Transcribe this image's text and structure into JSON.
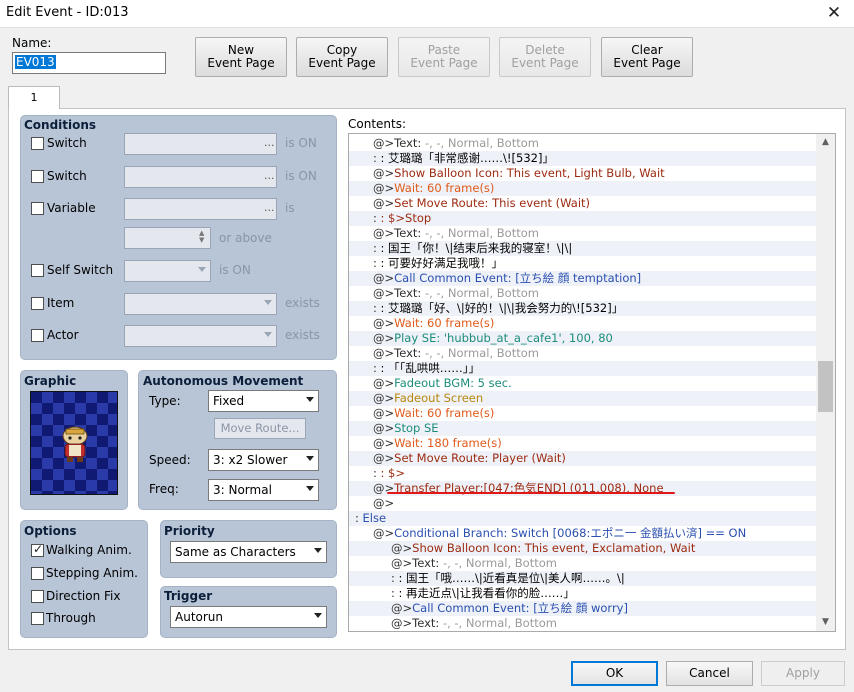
{
  "window": {
    "title": "Edit Event - ID:013",
    "close_glyph": "✕"
  },
  "name": {
    "label": "Name:",
    "value": "EV013"
  },
  "top_buttons": [
    {
      "line1": "New",
      "line2": "Event Page",
      "enabled": true
    },
    {
      "line1": "Copy",
      "line2": "Event Page",
      "enabled": true
    },
    {
      "line1": "Paste",
      "line2": "Event Page",
      "enabled": false
    },
    {
      "line1": "Delete",
      "line2": "Event Page",
      "enabled": false
    },
    {
      "line1": "Clear",
      "line2": "Event Page",
      "enabled": true
    }
  ],
  "tabs": [
    {
      "label": "1"
    }
  ],
  "conditions": {
    "title": "Conditions",
    "switch1": {
      "label": "Switch",
      "suffix": "is ON",
      "dots": "..."
    },
    "switch2": {
      "label": "Switch",
      "suffix": "is ON",
      "dots": "..."
    },
    "variable": {
      "label": "Variable",
      "suffix": "is",
      "dots": "...",
      "or_above": "or above"
    },
    "self_switch": {
      "label": "Self Switch",
      "suffix": "is ON"
    },
    "item": {
      "label": "Item",
      "suffix": "exists"
    },
    "actor": {
      "label": "Actor",
      "suffix": "exists"
    }
  },
  "graphic": {
    "title": "Graphic",
    "icon": "character-sprite-icon"
  },
  "autonomous": {
    "title": "Autonomous Movement",
    "type_label": "Type:",
    "type_value": "Fixed",
    "move_route": "Move Route...",
    "speed_label": "Speed:",
    "speed_value": "3: x2 Slower",
    "freq_label": "Freq:",
    "freq_value": "3: Normal"
  },
  "options": {
    "title": "Options",
    "items": [
      {
        "label": "Walking Anim.",
        "checked": true
      },
      {
        "label": "Stepping Anim.",
        "checked": false
      },
      {
        "label": "Direction Fix",
        "checked": false
      },
      {
        "label": "Through",
        "checked": false
      }
    ]
  },
  "priority": {
    "title": "Priority",
    "value": "Same as Characters"
  },
  "trigger": {
    "title": "Trigger",
    "value": "Autorun"
  },
  "contents": {
    "label": "Contents:",
    "rows": [
      {
        "indent": 0,
        "mk": "@>",
        "text": "Text: -, -, Normal, Bottom",
        "color": "#9a9a9a",
        "prefix": "Text: ",
        "prefix_color": "#303030"
      },
      {
        "indent": 0,
        "mk": " :",
        "text": "        : 艾璐璐「非常感谢……\\![532]」",
        "color": "#000000"
      },
      {
        "indent": 0,
        "mk": "@>",
        "text": "Show Balloon Icon: This event, Light Bulb, Wait",
        "color": "#9c2a10"
      },
      {
        "indent": 0,
        "mk": "@>",
        "text": "Wait: 60 frame(s)",
        "color": "#e05a1a"
      },
      {
        "indent": 0,
        "mk": "@>",
        "text": "Set Move Route: This event (Wait)",
        "color": "#9c2a10"
      },
      {
        "indent": 0,
        "mk": " :",
        "text": "                     : $>Stop",
        "color": "#9c2a10"
      },
      {
        "indent": 0,
        "mk": "@>",
        "text": "Text: -, -, Normal, Bottom",
        "color": "#9a9a9a",
        "prefix": "Text: ",
        "prefix_color": "#303030"
      },
      {
        "indent": 0,
        "mk": " :",
        "text": "        : 国王「你！\\|结束后来我的寝室！\\|\\|",
        "color": "#000000"
      },
      {
        "indent": 0,
        "mk": " :",
        "text": "        : 可要好好满足我哦！」",
        "color": "#000000"
      },
      {
        "indent": 0,
        "mk": "@>",
        "text": "Call Common Event: [立ち絵 顔 temptation]",
        "color": "#2a4fb0"
      },
      {
        "indent": 0,
        "mk": "@>",
        "text": "Text: -, -, Normal, Bottom",
        "color": "#9a9a9a",
        "prefix": "Text: ",
        "prefix_color": "#303030"
      },
      {
        "indent": 0,
        "mk": " :",
        "text": "        : 艾璐璐「好、\\|好的！\\|\\|我会努力的\\![532]」",
        "color": "#000000"
      },
      {
        "indent": 0,
        "mk": "@>",
        "text": "Wait: 60 frame(s)",
        "color": "#e05a1a"
      },
      {
        "indent": 0,
        "mk": "@>",
        "text": "Play SE: 'hubbub_at_a_cafe1', 100, 80",
        "color": "#1c8c7a"
      },
      {
        "indent": 0,
        "mk": "@>",
        "text": "Text: -, -, Normal, Bottom",
        "color": "#9a9a9a",
        "prefix": "Text: ",
        "prefix_color": "#303030"
      },
      {
        "indent": 0,
        "mk": " :",
        "text": "        : 「「乱哄哄……」」",
        "color": "#000000"
      },
      {
        "indent": 0,
        "mk": "@>",
        "text": "Fadeout BGM: 5 sec.",
        "color": "#1c8c7a"
      },
      {
        "indent": 0,
        "mk": "@>",
        "text": "Fadeout Screen",
        "color": "#b8860b"
      },
      {
        "indent": 0,
        "mk": "@>",
        "text": "Wait: 60 frame(s)",
        "color": "#e05a1a"
      },
      {
        "indent": 0,
        "mk": "@>",
        "text": "Stop SE",
        "color": "#1c8c7a"
      },
      {
        "indent": 0,
        "mk": "@>",
        "text": "Wait: 180 frame(s)",
        "color": "#e05a1a"
      },
      {
        "indent": 0,
        "mk": "@>",
        "text": "Set Move Route: Player (Wait)",
        "color": "#9c2a10"
      },
      {
        "indent": 0,
        "mk": " :",
        "text": "                     : $>",
        "color": "#9c2a10"
      },
      {
        "indent": 0,
        "mk": "@>",
        "text": "Transfer Player:[047:色気END] (011,008), None",
        "color": "#9c2a10"
      },
      {
        "indent": 0,
        "mk": "@>",
        "text": "",
        "color": "#000000"
      },
      {
        "indent": -1,
        "mk": ":",
        "text": " Else",
        "color": "#2a4fb0"
      },
      {
        "indent": 0,
        "mk": "@>",
        "text": "Conditional Branch: Switch [0068:エポニ一 金額払い済] == ON",
        "color": "#2a4fb0"
      },
      {
        "indent": 1,
        "mk": "@>",
        "text": "Show Balloon Icon: This event, Exclamation, Wait",
        "color": "#9c2a10"
      },
      {
        "indent": 1,
        "mk": "@>",
        "text": "Text: -, -, Normal, Bottom",
        "color": "#9a9a9a",
        "prefix": "Text: ",
        "prefix_color": "#303030"
      },
      {
        "indent": 1,
        "mk": " :",
        "text": "        : 国王「哦……\\|近看真是位\\|美人啊……。\\|",
        "color": "#000000"
      },
      {
        "indent": 1,
        "mk": " :",
        "text": "        : 再走近点\\|让我看看你的脸……」",
        "color": "#000000"
      },
      {
        "indent": 1,
        "mk": "@>",
        "text": "Call Common Event: [立ち絵 顔 worry]",
        "color": "#2a4fb0"
      },
      {
        "indent": 1,
        "mk": "@>",
        "text": "Text: -, -, Normal, Bottom",
        "color": "#9a9a9a",
        "prefix": "Text: ",
        "prefix_color": "#303030"
      }
    ]
  },
  "bottom_buttons": {
    "ok": "OK",
    "cancel": "Cancel",
    "apply": "Apply"
  },
  "colors": {
    "group_bg": "#b8c5d6",
    "selection": "#0078d7",
    "highlight_line": "#e01818"
  }
}
